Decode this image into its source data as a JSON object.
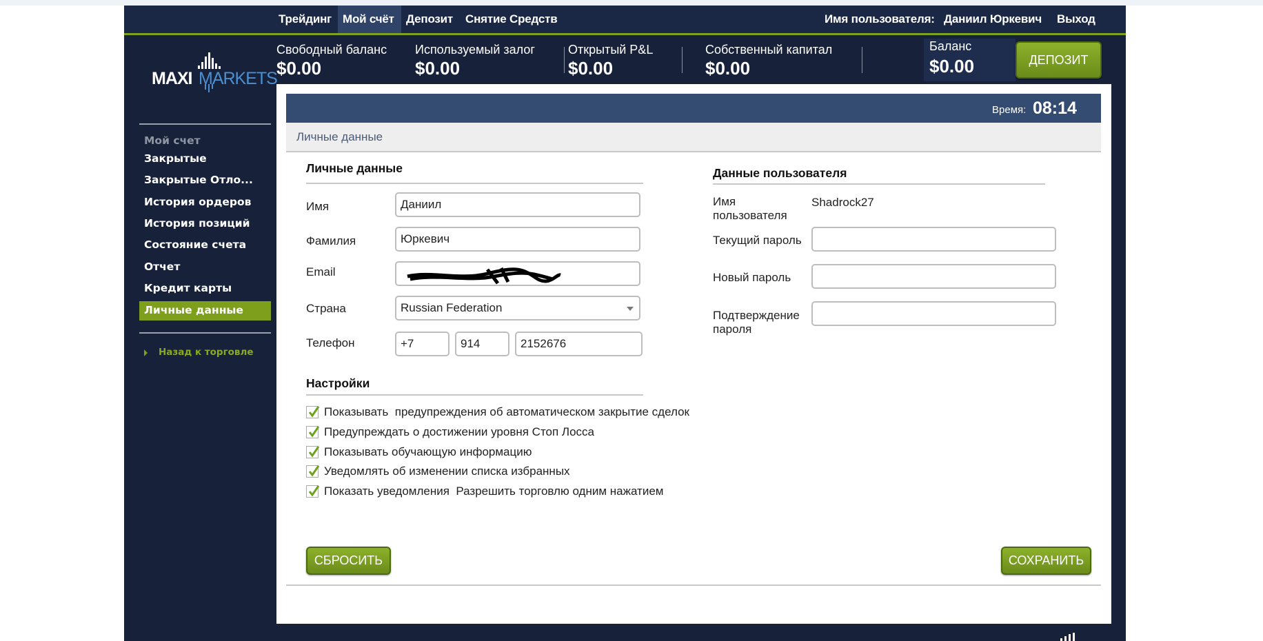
{
  "nav": {
    "items": [
      "Трейдинг",
      "Мой счёт",
      "Депозит",
      "Снятие Средств"
    ],
    "user_label": "Имя пользователя:",
    "user_name": "Даниил Юркевич",
    "logout": "Выход"
  },
  "logo": {
    "text_a": "MAXI",
    "text_b": "MARKETS"
  },
  "stats": [
    {
      "label": "Свободный баланс",
      "value": "$0.00"
    },
    {
      "label": "Используемый залог",
      "value": "$0.00"
    },
    {
      "label": "Открытый P&L",
      "value": "$0.00"
    },
    {
      "label": "Собственный капитал",
      "value": "$0.00"
    },
    {
      "label": "Баланс",
      "value": "$0.00"
    }
  ],
  "deposit_button": "ДЕПОЗИТ",
  "time": {
    "label": "Время:",
    "value": "08:14"
  },
  "breadcrumb": "Личные данные",
  "sidebar": {
    "section": "Мой счет",
    "items": [
      "Закрытые",
      "Закрытые Отло...",
      "История ордеров",
      "История позиций",
      "Состояние счета",
      "Отчет",
      "Кредит карты",
      "Личные данные"
    ],
    "active": "Личные данные",
    "back": "Назад к торговле"
  },
  "personal": {
    "title": "Личные данные",
    "first_name_label": "Имя",
    "first_name": "Даниил",
    "last_name_label": "Фамилия",
    "last_name": "Юркевич",
    "email_label": "Email",
    "country_label": "Страна",
    "country": "Russian Federation",
    "phone_label": "Телефон",
    "phone_code": "+7",
    "phone_area": "914",
    "phone_number": "2152676"
  },
  "settings": {
    "title": "Настройки",
    "options": [
      {
        "label": "Показывать  предупреждения об автоматическом закрытие сделок",
        "checked": true
      },
      {
        "label": "Предупреждать о достижении уровня Стоп Лосса",
        "checked": true
      },
      {
        "label": "Показывать обучающую информацию",
        "checked": true
      },
      {
        "label": "Уведомлять об изменении списка избранных",
        "checked": true
      },
      {
        "label": "Показать уведомления  Разрешить торговлю одним нажатием",
        "checked": true
      }
    ]
  },
  "user": {
    "title": "Данные пользователя",
    "username_label": "Имя пользователя",
    "username": "Shadrock27",
    "current_password_label": "Текущий пароль",
    "new_password_label": "Новый пароль",
    "confirm_password_label": "Подтверждение пароля"
  },
  "buttons": {
    "reset": "СБРОСИТЬ",
    "save": "СОХРАНИТЬ"
  },
  "colors": {
    "accent": "#7da21e",
    "dark": "#17213a",
    "header_bar": "#344b72"
  }
}
